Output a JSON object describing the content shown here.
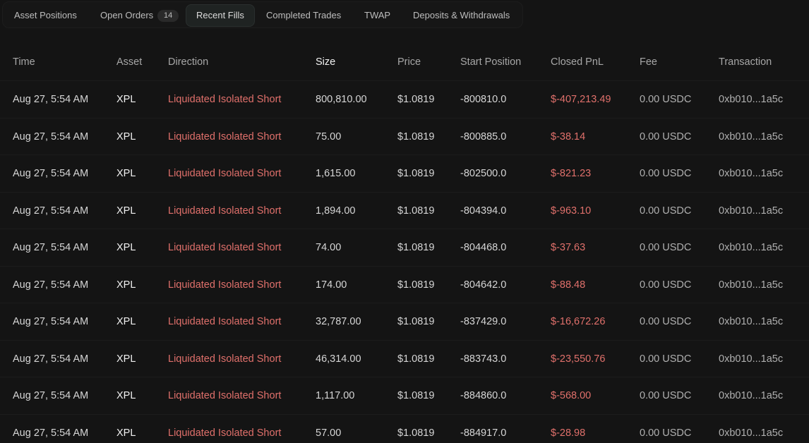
{
  "tabs": [
    {
      "label": "Asset Positions"
    },
    {
      "label": "Open Orders",
      "badge": "14"
    },
    {
      "label": "Recent Fills"
    },
    {
      "label": "Completed Trades"
    },
    {
      "label": "TWAP"
    },
    {
      "label": "Deposits & Withdrawals"
    }
  ],
  "active_tab": "Recent Fills",
  "columns": {
    "time": "Time",
    "asset": "Asset",
    "direction": "Direction",
    "size": "Size",
    "price": "Price",
    "start_position": "Start Position",
    "closed_pnl": "Closed PnL",
    "fee": "Fee",
    "transaction": "Transaction"
  },
  "rows": [
    {
      "time": "Aug 27, 5:54 AM",
      "asset": "XPL",
      "direction": "Liquidated Isolated Short",
      "size": "800,810.00",
      "price": "$1.0819",
      "start_position": "-800810.0",
      "closed_pnl": "$-407,213.49",
      "fee": "0.00 USDC",
      "transaction": "0xb010...1a5c"
    },
    {
      "time": "Aug 27, 5:54 AM",
      "asset": "XPL",
      "direction": "Liquidated Isolated Short",
      "size": "75.00",
      "price": "$1.0819",
      "start_position": "-800885.0",
      "closed_pnl": "$-38.14",
      "fee": "0.00 USDC",
      "transaction": "0xb010...1a5c"
    },
    {
      "time": "Aug 27, 5:54 AM",
      "asset": "XPL",
      "direction": "Liquidated Isolated Short",
      "size": "1,615.00",
      "price": "$1.0819",
      "start_position": "-802500.0",
      "closed_pnl": "$-821.23",
      "fee": "0.00 USDC",
      "transaction": "0xb010...1a5c"
    },
    {
      "time": "Aug 27, 5:54 AM",
      "asset": "XPL",
      "direction": "Liquidated Isolated Short",
      "size": "1,894.00",
      "price": "$1.0819",
      "start_position": "-804394.0",
      "closed_pnl": "$-963.10",
      "fee": "0.00 USDC",
      "transaction": "0xb010...1a5c"
    },
    {
      "time": "Aug 27, 5:54 AM",
      "asset": "XPL",
      "direction": "Liquidated Isolated Short",
      "size": "74.00",
      "price": "$1.0819",
      "start_position": "-804468.0",
      "closed_pnl": "$-37.63",
      "fee": "0.00 USDC",
      "transaction": "0xb010...1a5c"
    },
    {
      "time": "Aug 27, 5:54 AM",
      "asset": "XPL",
      "direction": "Liquidated Isolated Short",
      "size": "174.00",
      "price": "$1.0819",
      "start_position": "-804642.0",
      "closed_pnl": "$-88.48",
      "fee": "0.00 USDC",
      "transaction": "0xb010...1a5c"
    },
    {
      "time": "Aug 27, 5:54 AM",
      "asset": "XPL",
      "direction": "Liquidated Isolated Short",
      "size": "32,787.00",
      "price": "$1.0819",
      "start_position": "-837429.0",
      "closed_pnl": "$-16,672.26",
      "fee": "0.00 USDC",
      "transaction": "0xb010...1a5c"
    },
    {
      "time": "Aug 27, 5:54 AM",
      "asset": "XPL",
      "direction": "Liquidated Isolated Short",
      "size": "46,314.00",
      "price": "$1.0819",
      "start_position": "-883743.0",
      "closed_pnl": "$-23,550.76",
      "fee": "0.00 USDC",
      "transaction": "0xb010...1a5c"
    },
    {
      "time": "Aug 27, 5:54 AM",
      "asset": "XPL",
      "direction": "Liquidated Isolated Short",
      "size": "1,117.00",
      "price": "$1.0819",
      "start_position": "-884860.0",
      "closed_pnl": "$-568.00",
      "fee": "0.00 USDC",
      "transaction": "0xb010...1a5c"
    },
    {
      "time": "Aug 27, 5:54 AM",
      "asset": "XPL",
      "direction": "Liquidated Isolated Short",
      "size": "57.00",
      "price": "$1.0819",
      "start_position": "-884917.0",
      "closed_pnl": "$-28.98",
      "fee": "0.00 USDC",
      "transaction": "0xb010...1a5c"
    }
  ],
  "colors": {
    "background": "#141414",
    "loss_red": "#e0706b",
    "header_text": "#a7a7a7"
  }
}
